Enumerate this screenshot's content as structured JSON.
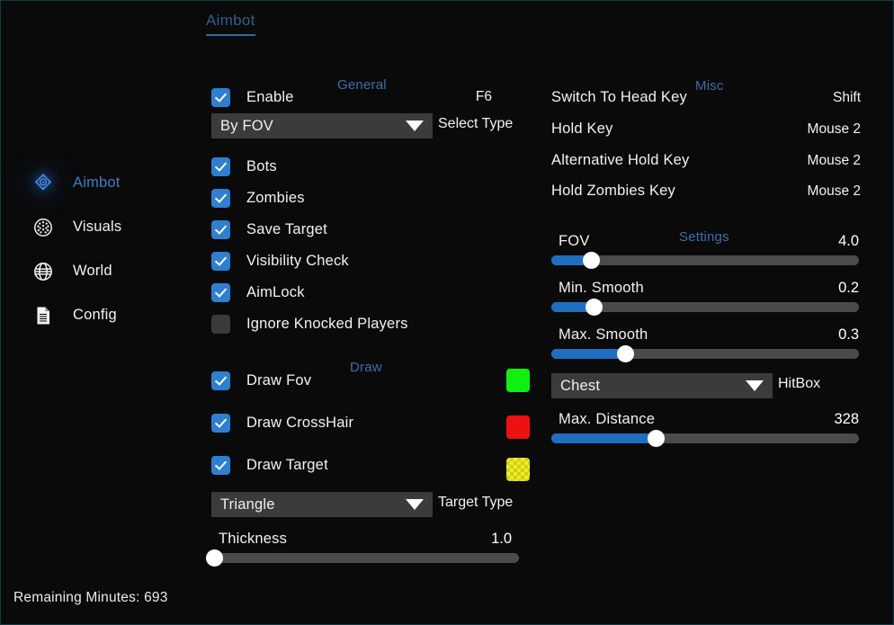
{
  "window": {
    "border_color": "#123a47",
    "background": "#0a0a0b"
  },
  "tabs": [
    {
      "label": "Aimbot",
      "active": true
    }
  ],
  "sidebar": {
    "items": [
      {
        "label": "Aimbot",
        "icon": "crosshair-target-icon",
        "active": true
      },
      {
        "label": "Visuals",
        "icon": "mesh-circle-icon",
        "active": false
      },
      {
        "label": "World",
        "icon": "globe-icon",
        "active": false
      },
      {
        "label": "Config",
        "icon": "document-icon",
        "active": false
      }
    ]
  },
  "general": {
    "title": "General",
    "enable": {
      "label": "Enable",
      "checked": true,
      "hotkey": "F6"
    },
    "select_type": {
      "value": "By FOV",
      "tag": "Select Type"
    },
    "checkboxes": [
      {
        "label": "Bots",
        "checked": true
      },
      {
        "label": "Zombies",
        "checked": true
      },
      {
        "label": "Save Target",
        "checked": true
      },
      {
        "label": "Visibility Check",
        "checked": true
      },
      {
        "label": "AimLock",
        "checked": true
      },
      {
        "label": "Ignore Knocked Players",
        "checked": false
      }
    ]
  },
  "draw": {
    "title": "Draw",
    "rows": [
      {
        "label": "Draw Fov",
        "checked": true,
        "color": "#11ef11",
        "checker": false
      },
      {
        "label": "Draw CrossHair",
        "checked": true,
        "color": "#ee1111",
        "checker": false
      },
      {
        "label": "Draw Target",
        "checked": true,
        "color": "#eeee22",
        "checker": true
      }
    ],
    "target_type": {
      "value": "Triangle",
      "tag": "Target Type"
    },
    "thickness": {
      "label": "Thickness",
      "value": "1.0",
      "percent": 1
    }
  },
  "misc": {
    "title": "Misc",
    "rows": [
      {
        "label": "Switch To Head Key",
        "value": "Shift"
      },
      {
        "label": "Hold Key",
        "value": "Mouse 2"
      },
      {
        "label": "Alternative Hold Key",
        "value": "Mouse 2"
      },
      {
        "label": "Hold Zombies Key",
        "value": "Mouse 2"
      }
    ]
  },
  "settings": {
    "title": "Settings",
    "sliders": [
      {
        "label": "FOV",
        "value": "4.0",
        "percent": 13
      },
      {
        "label": "Min. Smooth",
        "value": "0.2",
        "percent": 14
      },
      {
        "label": "Max. Smooth",
        "value": "0.3",
        "percent": 24
      },
      {
        "label": "Max. Distance",
        "value": "328",
        "percent": 34
      }
    ],
    "hitbox": {
      "value": "Chest",
      "tag": "HitBox"
    }
  },
  "footer": {
    "status": "Remaining Minutes: 693"
  },
  "theme": {
    "accent": "#2e7fd0",
    "section_title": "#3a6fa8",
    "slider_fill": "#1f6fc0",
    "slider_track": "#4b4b4b",
    "dropdown_bg": "#3b3b3b"
  }
}
